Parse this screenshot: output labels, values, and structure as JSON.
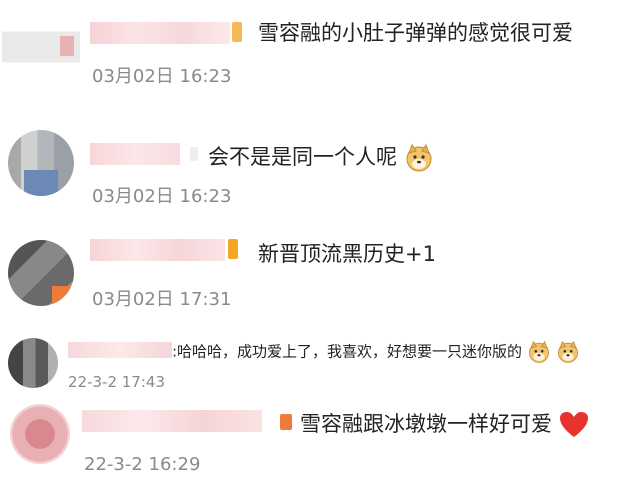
{
  "comments": [
    {
      "text": "雪容融的小肚子弹弹的感觉很可爱",
      "time": "03月02日 16:23"
    },
    {
      "text": "会不是是同一个人呢",
      "time": "03月02日 16:23",
      "emoji": "doge-face-icon"
    },
    {
      "text": "新晋顶流黑历史+1",
      "time": "03月02日 17:31"
    },
    {
      "text": ":哈哈哈，成功爱上了，我喜欢，好想要一只迷你版的",
      "time": "22-3-2 17:43",
      "emoji": "doge-face-icon"
    },
    {
      "text": "雪容融跟冰墩墩一样好可爱",
      "time": "22-3-2 16:29",
      "emoji": "red-heart-icon"
    }
  ],
  "colors": {
    "text": "#222222",
    "time": "#8a8a8a",
    "badge_orange": "#f5a623",
    "heart": "#e8322f"
  }
}
